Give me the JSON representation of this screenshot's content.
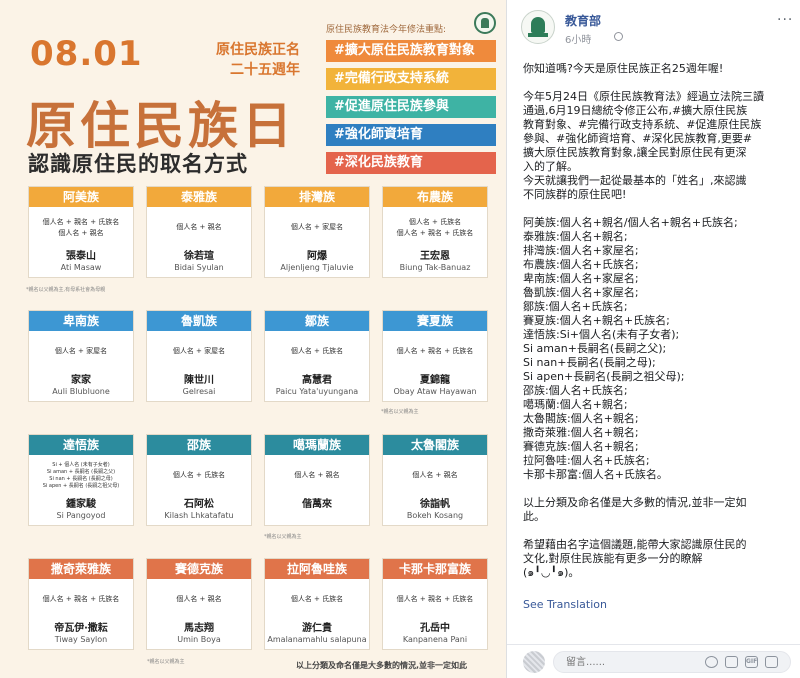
{
  "poster": {
    "date": "08.01",
    "anniversary_line1": "原住民族正名",
    "anniversary_line2": "二十五週年",
    "title": "原住民族日",
    "subtitle": "認識原住民的取名方式",
    "focus_heading": "原住民族教育法今年修法重點:",
    "focus_items": [
      {
        "label": "#擴大原住民族教育對象",
        "color": "#ef8a3c"
      },
      {
        "label": "#完備行政支持系統",
        "color": "#f2b33a"
      },
      {
        "label": "#促進原住民族參與",
        "color": "#3eb3a4"
      },
      {
        "label": "#強化師資培育",
        "color": "#2f7fc1"
      },
      {
        "label": "#深化民族教育",
        "color": "#e4644c"
      }
    ],
    "cards": [
      {
        "tribe": "阿美族",
        "rule1": "個人名 + 親名 + 氏族名",
        "rule2": "個人名 + 親名",
        "rule3": "",
        "rule4": "",
        "example": "張泰山",
        "romaji": "Ati Masaw",
        "color": "#f2a93b"
      },
      {
        "tribe": "泰雅族",
        "rule1": "個人名 + 親名",
        "rule2": "",
        "rule3": "",
        "rule4": "",
        "example": "徐若瑄",
        "romaji": "Bidai Syulan",
        "color": "#f2a93b"
      },
      {
        "tribe": "排灣族",
        "rule1": "個人名 + 家屋名",
        "rule2": "",
        "rule3": "",
        "rule4": "",
        "example": "阿爆",
        "romaji": "Aljenljeng Tjaluvie",
        "color": "#f2a93b"
      },
      {
        "tribe": "布農族",
        "rule1": "個人名 + 氏族名",
        "rule2": "個人名 + 親名 + 氏族名",
        "rule3": "",
        "rule4": "",
        "example": "王宏恩",
        "romaji": "Biung Tak-Banuaz",
        "color": "#f2a93b"
      },
      {
        "tribe": "卑南族",
        "rule1": "個人名 + 家屋名",
        "rule2": "",
        "rule3": "",
        "rule4": "",
        "example": "家家",
        "romaji": "Auli Blubluone",
        "color": "#3d97d3"
      },
      {
        "tribe": "魯凱族",
        "rule1": "個人名 + 家屋名",
        "rule2": "",
        "rule3": "",
        "rule4": "",
        "example": "陳世川",
        "romaji": "Gelresai",
        "color": "#3d97d3"
      },
      {
        "tribe": "鄒族",
        "rule1": "個人名 + 氏族名",
        "rule2": "",
        "rule3": "",
        "rule4": "",
        "example": "高慧君",
        "romaji": "Paicu Yata'uyungana",
        "color": "#3d97d3"
      },
      {
        "tribe": "賽夏族",
        "rule1": "個人名 + 親名 + 氏族名",
        "rule2": "",
        "rule3": "",
        "rule4": "",
        "example": "夏錦龍",
        "romaji": "Obay Ataw Hayawan",
        "color": "#3d97d3"
      },
      {
        "tribe": "達悟族",
        "rule1": "Si + 個人名 (未有子女者)",
        "rule2": "Si aman + 長嗣名 (長嗣之父)",
        "rule3": "Si nan + 長嗣名 (長嗣之母)",
        "rule4": "Si apen + 長嗣名 (長嗣之祖父母)",
        "example": "鍾家駿",
        "romaji": "Si Pangoyod",
        "color": "#2c8c9e"
      },
      {
        "tribe": "邵族",
        "rule1": "個人名 + 氏族名",
        "rule2": "",
        "rule3": "",
        "rule4": "",
        "example": "石阿松",
        "romaji": "Kilash Lhkatafatu",
        "color": "#2c8c9e"
      },
      {
        "tribe": "噶瑪蘭族",
        "rule1": "個人名 + 親名",
        "rule2": "",
        "rule3": "",
        "rule4": "",
        "example": "偕萬來",
        "romaji": "",
        "color": "#2c8c9e"
      },
      {
        "tribe": "太魯閣族",
        "rule1": "個人名 + 親名",
        "rule2": "",
        "rule3": "",
        "rule4": "",
        "example": "徐詣帆",
        "romaji": "Bokeh Kosang",
        "color": "#2c8c9e"
      },
      {
        "tribe": "撒奇萊雅族",
        "rule1": "個人名 + 親名 + 氏族名",
        "rule2": "",
        "rule3": "",
        "rule4": "",
        "example": "帝瓦伊‧撒耘",
        "romaji": "Tiway Saylon",
        "color": "#e0744a"
      },
      {
        "tribe": "賽德克族",
        "rule1": "個人名 + 親名",
        "rule2": "",
        "rule3": "",
        "rule4": "",
        "example": "馬志翔",
        "romaji": "Umin Boya",
        "color": "#e0744a"
      },
      {
        "tribe": "拉阿魯哇族",
        "rule1": "個人名 + 氏族名",
        "rule2": "",
        "rule3": "",
        "rule4": "",
        "example": "游仁貴",
        "romaji": "Amalanamahlu salapuna",
        "color": "#e0744a"
      },
      {
        "tribe": "卡那卡那富族",
        "rule1": "個人名 + 親名 + 氏族名",
        "rule2": "",
        "rule3": "",
        "rule4": "",
        "example": "孔岳中",
        "romaji": "Kanpanena Pani",
        "color": "#e0744a"
      }
    ],
    "note_amis": "*親名以父親為主,有母系社會為母親",
    "note_paternal": "*親名以父親為主",
    "footer": "以上分類及命名僅是大多數的情況,並非一定如此"
  },
  "post": {
    "page_name": "教育部",
    "time": "6小時",
    "more": "···",
    "body": [
      {
        "lines": [
          "你知道嗎?今天是原住民族正名25週年喔!"
        ]
      },
      {
        "lines": [
          "今年5月24日《原住民族教育法》經過立法院三讀",
          "通過,6月19日總統令修正公布,#擴大原住民族",
          "教育對象、#完備行政支持系統、#促進原住民族",
          "參與、#強化師資培育、#深化民族教育,更要#",
          "擴大原住民族教育對象,讓全民對原住民有更深",
          "入的了解。",
          "今天就讓我們一起從最基本的「姓名」,來認識",
          "不同族群的原住民吧!"
        ]
      },
      {
        "lines": [
          "阿美族:個人名+親名/個人名+親名+氏族名;",
          "泰雅族:個人名+親名;",
          "排灣族:個人名+家屋名;",
          "布農族:個人名+氏族名;",
          "卑南族:個人名+家屋名;",
          "魯凱族:個人名+家屋名;",
          "鄒族:個人名+氏族名;",
          "賽夏族:個人名+親名+氏族名;",
          "達悟族:Si+個人名(未有子女者);",
          "Si aman+長嗣名(長嗣之父);",
          "Si nan+長嗣名(長嗣之母);",
          "Si apen+長嗣名(長嗣之祖父母);",
          "邵族:個人名+氏族名;",
          "噶瑪蘭:個人名+親名;",
          "太魯閣族:個人名+親名;",
          "撒奇萊雅:個人名+親名;",
          "賽德克族:個人名+親名;",
          "拉阿魯哇:個人名+氏族名;",
          "卡那卡那富:個人名+氏族名。"
        ]
      },
      {
        "lines": [
          "以上分類及命名僅是大多數的情況,並非一定如",
          "此。"
        ]
      },
      {
        "lines": [
          "希望藉由名字這個議題,能帶大家認識原住民的",
          "文化,對原住民族能有更多一分的瞭解",
          "(๑╹◡╹๑)。"
        ]
      }
    ],
    "see_translation": "See Translation",
    "comment_placeholder": "留言......"
  }
}
